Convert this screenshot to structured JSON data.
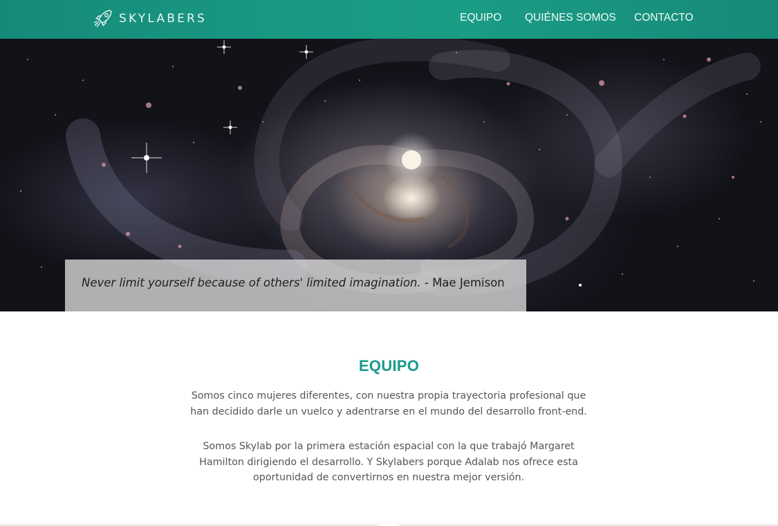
{
  "brand": {
    "name": "SKYLABERS",
    "icon": "rocket-icon"
  },
  "nav": {
    "items": [
      {
        "label": "EQUIPO"
      },
      {
        "label": "QUIÉNES SOMOS"
      },
      {
        "label": "CONTACTO"
      }
    ]
  },
  "hero": {
    "quote": "Never limit yourself because of others' limited imagination.",
    "author": "- Mae Jemison"
  },
  "team": {
    "title": "EQUIPO",
    "paragraph1": "Somos cinco mujeres diferentes, con nuestra propia trayectoria profesional que han decidido darle un vuelco y adentrarse en el mundo del desarrollo front-end.",
    "paragraph2": "Somos Skylab por la primera estación espacial con la que trabajó Margaret Hamilton dirigiendo el desarrollo. Y Skylabers porque Adalab nos ofrece esta oportunidad de convertirnos en nuestra mejor versión."
  },
  "colors": {
    "header": "#1b9c85",
    "accent": "#18998a",
    "text": "#555555"
  }
}
